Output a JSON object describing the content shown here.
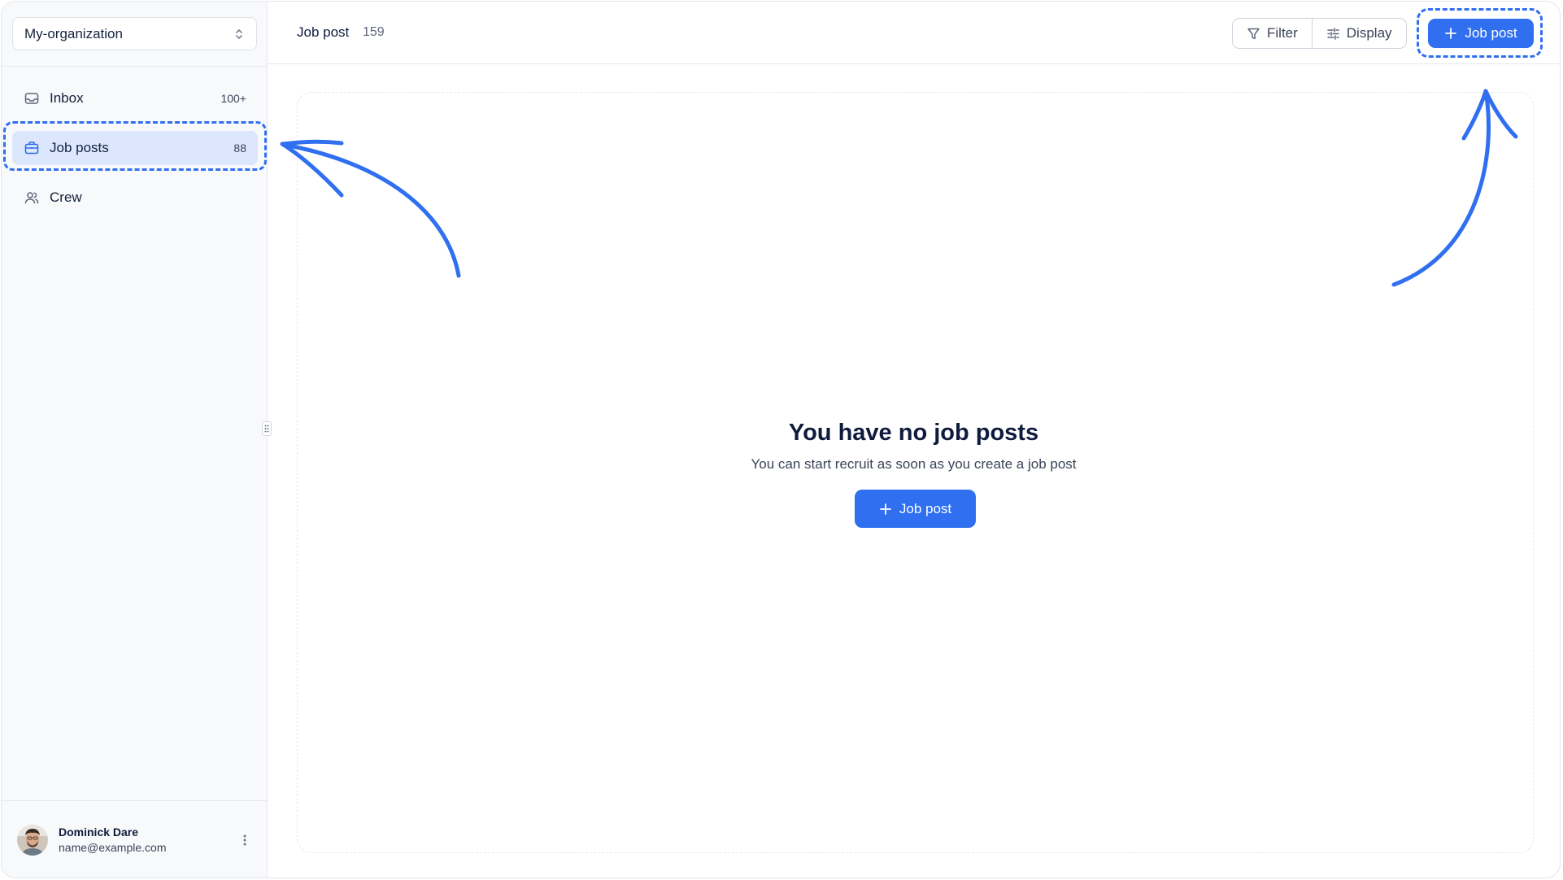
{
  "sidebar": {
    "org_selector": {
      "value": "My-organization"
    },
    "items": [
      {
        "label": "Inbox",
        "count": "100+",
        "icon": "inbox-icon"
      },
      {
        "label": "Job posts",
        "count": "88",
        "icon": "briefcase-icon",
        "active": true
      },
      {
        "label": "Crew",
        "count": "",
        "icon": "users-icon"
      }
    ],
    "user": {
      "name": "Dominick Dare",
      "email": "name@example.com"
    }
  },
  "header": {
    "title": "Job post",
    "count": "159",
    "filter_label": "Filter",
    "display_label": "Display",
    "add_label": "Job post"
  },
  "empty_state": {
    "title": "You have no job posts",
    "subtitle": "You can start recruit as soon as you create a job post",
    "button_label": "Job post"
  },
  "colors": {
    "accent": "#2f6ff0",
    "active_nav_bg": "#dce7fd",
    "annotation": "#2f6ff0"
  }
}
